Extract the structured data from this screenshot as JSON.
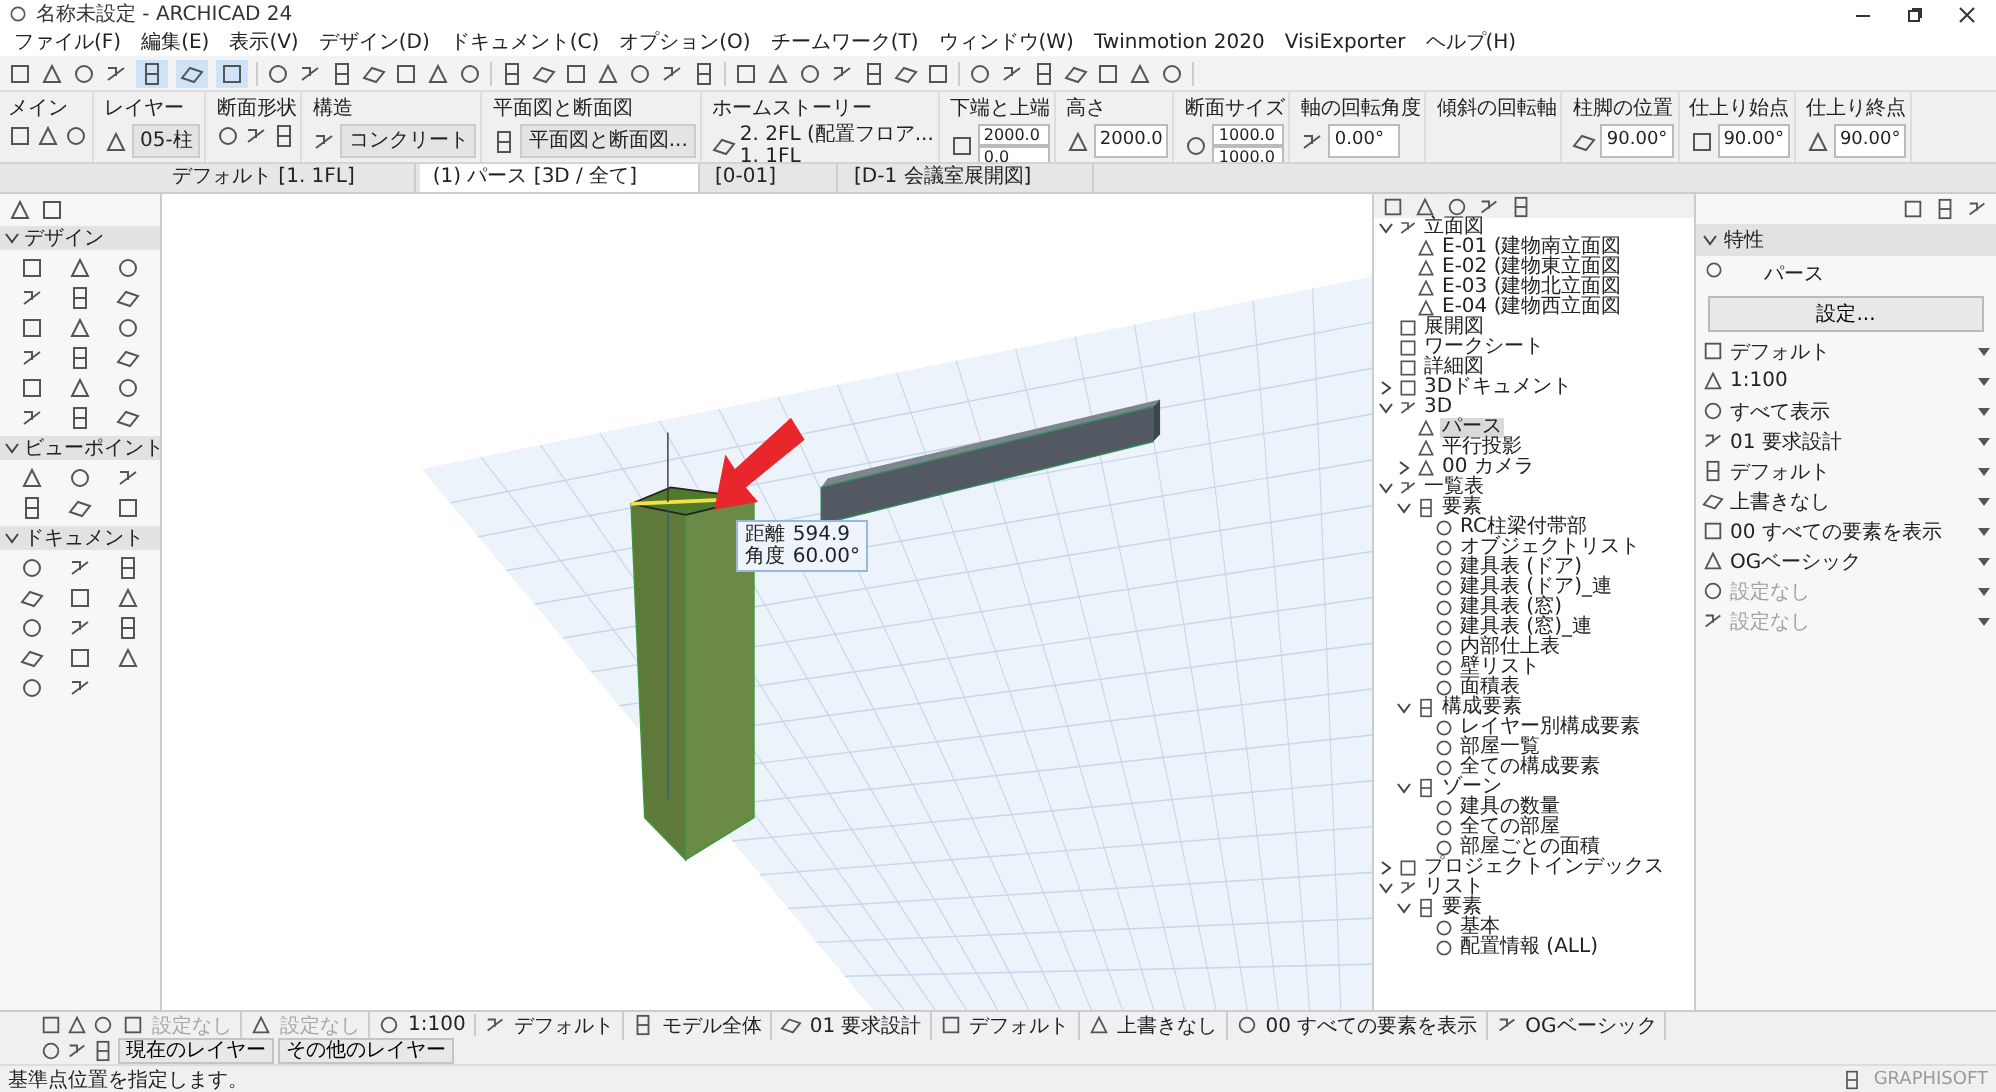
{
  "window": {
    "title": "名称未設定 - ARCHICAD 24"
  },
  "menu_bar": [
    "ファイル(F)",
    "編集(E)",
    "表示(V)",
    "デザイン(D)",
    "ドキュメント(C)",
    "オプション(O)",
    "チームワーク(T)",
    "ウィンドウ(W)",
    "Twinmotion 2020",
    "VisiExporter",
    "ヘルプ(H)"
  ],
  "info_box": [
    {
      "label": "メイン",
      "kind": "icons"
    },
    {
      "label": "レイヤー",
      "kind": "dropdown",
      "values": [
        "05-柱"
      ]
    },
    {
      "label": "断面形状",
      "kind": "icons"
    },
    {
      "label": "構造",
      "kind": "dropdown",
      "values": [
        "コンクリート"
      ]
    },
    {
      "label": "平面図と断面図",
      "kind": "dropdown",
      "values": [
        "平面図と断面図..."
      ]
    },
    {
      "label": "ホームストーリー",
      "kind": "stack",
      "values": [
        "2. 2FL (配置フロア...",
        "1. 1FL"
      ]
    },
    {
      "label": "下端と上端",
      "kind": "fields",
      "values": [
        "2000.0",
        "0.0"
      ]
    },
    {
      "label": "高さ",
      "kind": "fields",
      "values": [
        "2000.0"
      ]
    },
    {
      "label": "断面サイズ",
      "kind": "fields",
      "values": [
        "1000.0",
        "1000.0"
      ]
    },
    {
      "label": "軸の回転角度",
      "kind": "fields",
      "values": [
        "0.00°"
      ]
    },
    {
      "label": "傾斜の回転軸",
      "kind": "empty"
    },
    {
      "label": "柱脚の位置",
      "kind": "fields",
      "values": [
        "90.00°"
      ]
    },
    {
      "label": "仕上り始点",
      "kind": "fields",
      "values": [
        "90.00°"
      ]
    },
    {
      "label": "仕上り終点",
      "kind": "fields",
      "values": [
        "90.00°"
      ]
    }
  ],
  "view_tabs": [
    {
      "label": "デフォルト [1. 1FL]",
      "selected": false
    },
    {
      "label": "(1) パース [3D / 全て]",
      "selected": true
    },
    {
      "label": "[0-01]",
      "selected": false
    },
    {
      "label": "[D-1 会議室展開図]",
      "selected": false
    }
  ],
  "toolbox": [
    {
      "title": "デザイン",
      "expanded": true
    },
    {
      "title": "ビューポイント",
      "expanded": true
    },
    {
      "title": "ドキュメント",
      "expanded": true
    }
  ],
  "viewport": {
    "tooltip": [
      {
        "label": "距離",
        "value": "594.9"
      },
      {
        "label": "角度",
        "value": "60.00°"
      }
    ]
  },
  "navigator": [
    {
      "label": "立面図",
      "expanded": true,
      "selected": false,
      "children": [
        {
          "label": "E-01 (建物南立面図",
          "selected": false
        },
        {
          "label": "E-02 (建物東立面図",
          "selected": false
        },
        {
          "label": "E-03 (建物北立面図",
          "selected": false
        },
        {
          "label": "E-04 (建物西立面図",
          "selected": false
        }
      ]
    },
    {
      "label": "展開図",
      "selected": false
    },
    {
      "label": "ワークシート",
      "selected": false
    },
    {
      "label": "詳細図",
      "selected": false
    },
    {
      "label": "3Dドキュメント",
      "expanded": false,
      "selected": false
    },
    {
      "label": "3D",
      "expanded": true,
      "selected": false,
      "children": [
        {
          "label": "パース",
          "selected": true
        },
        {
          "label": "平行投影",
          "selected": false
        },
        {
          "label": "00 カメラ",
          "expanded": false,
          "selected": false
        }
      ]
    },
    {
      "label": "一覧表",
      "expanded": true,
      "selected": false,
      "children": [
        {
          "label": "要素",
          "expanded": true,
          "selected": false,
          "children": [
            {
              "label": "RC柱梁付帯部",
              "selected": false
            },
            {
              "label": "オブジェクトリスト",
              "selected": false
            },
            {
              "label": "建具表 (ドア)",
              "selected": false
            },
            {
              "label": "建具表 (ドア)_連",
              "selected": false
            },
            {
              "label": "建具表 (窓)",
              "selected": false
            },
            {
              "label": "建具表 (窓)_連",
              "selected": false
            },
            {
              "label": "内部仕上表",
              "selected": false
            },
            {
              "label": "壁リスト",
              "selected": false
            },
            {
              "label": "面積表",
              "selected": false
            }
          ]
        },
        {
          "label": "構成要素",
          "expanded": true,
          "selected": false,
          "children": [
            {
              "label": "レイヤー別構成要素",
              "selected": false
            },
            {
              "label": "部屋一覧",
              "selected": false
            },
            {
              "label": "全ての構成要素",
              "selected": false
            }
          ]
        },
        {
          "label": "ゾーン",
          "expanded": true,
          "selected": false,
          "children": [
            {
              "label": "建具の数量",
              "selected": false
            },
            {
              "label": "全ての部屋",
              "selected": false
            },
            {
              "label": "部屋ごとの面積",
              "selected": false
            }
          ]
        }
      ]
    },
    {
      "label": "プロジェクトインデックス",
      "expanded": false,
      "selected": false
    },
    {
      "label": "リスト",
      "expanded": true,
      "selected": false,
      "children": [
        {
          "label": "要素",
          "expanded": true,
          "selected": false,
          "children": [
            {
              "label": "基本",
              "selected": false
            },
            {
              "label": "配置情報 (ALL)",
              "selected": false
            }
          ]
        }
      ]
    }
  ],
  "properties": {
    "title": "特性",
    "view_name": "パース",
    "settings_button": "設定...",
    "items": [
      {
        "label": "デフォルト",
        "disabled": false
      },
      {
        "label": "1:100",
        "disabled": false
      },
      {
        "label": "すべて表示",
        "disabled": false
      },
      {
        "label": "01 要求設計",
        "disabled": false
      },
      {
        "label": "デフォルト",
        "disabled": false
      },
      {
        "label": "上書きなし",
        "disabled": false
      },
      {
        "label": "00 すべての要素を表示",
        "disabled": false
      },
      {
        "label": "OGベーシック",
        "disabled": false
      },
      {
        "label": "設定なし",
        "disabled": true
      },
      {
        "label": "設定なし",
        "disabled": true
      }
    ]
  },
  "quick_options": [
    {
      "label": "設定なし",
      "disabled": true
    },
    {
      "label": "設定なし",
      "disabled": true
    },
    {
      "label": "1:100",
      "disabled": false
    },
    {
      "label": "デフォルト",
      "disabled": false
    },
    {
      "label": "モデル全体",
      "disabled": false
    },
    {
      "label": "01 要求設計",
      "disabled": false
    },
    {
      "label": "デフォルト",
      "disabled": false
    },
    {
      "label": "上書きなし",
      "disabled": false
    },
    {
      "label": "00 すべての要素を表示",
      "disabled": false
    },
    {
      "label": "OGベーシック",
      "disabled": false
    }
  ],
  "layer_buttons": [
    "現在のレイヤー",
    "その他のレイヤー"
  ],
  "status_bar": {
    "text": "基準点位置を指定します。",
    "brand": "GRAPHISOFT"
  }
}
